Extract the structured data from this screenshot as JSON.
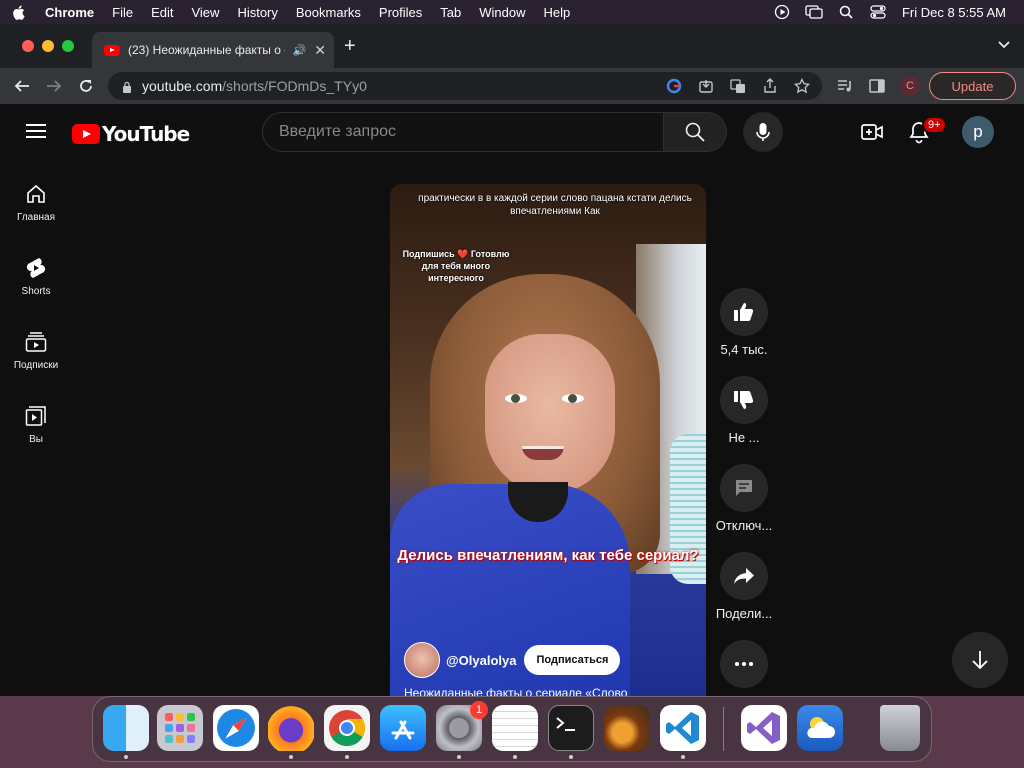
{
  "menubar": {
    "app_name": "Chrome",
    "items": [
      "File",
      "Edit",
      "View",
      "History",
      "Bookmarks",
      "Profiles",
      "Tab",
      "Window",
      "Help"
    ],
    "clock": "Fri Dec 8  5:55 AM"
  },
  "browser": {
    "tab_title": "(23) Неожиданные факты о сериале «Слово",
    "url_host": "youtube.com",
    "url_path": "/shorts/FODmDs_TYy0",
    "profile_letter": "C",
    "update_label": "Update"
  },
  "youtube": {
    "logo_text": "YouTube",
    "search_placeholder": "Введите запрос",
    "notification_count": "9+",
    "avatar_letter": "p",
    "sidebar": [
      {
        "label": "Главная",
        "icon": "home-icon"
      },
      {
        "label": "Shorts",
        "icon": "shorts-icon"
      },
      {
        "label": "Подписки",
        "icon": "subscriptions-icon"
      },
      {
        "label": "Вы",
        "icon": "you-icon"
      }
    ],
    "short": {
      "caption_top": "практически в в каждой серии слово пацана кстати делись впечатлениями Как",
      "caption_side": "Подпишись ❤️ Готовлю для тебя много интересного",
      "caption_main": "Делись впечатлениям, как тебе сериал?",
      "channel": "@Olyalolya",
      "subscribe_label": "Подписаться",
      "title": "Неожиданные факты о сериале «Слово"
    },
    "actions": {
      "likes": "5,4 тыс.",
      "dislike": "Не ...",
      "comments": "Отключ...",
      "share": "Подели..."
    }
  },
  "dock": {
    "settings_badge": "1"
  }
}
